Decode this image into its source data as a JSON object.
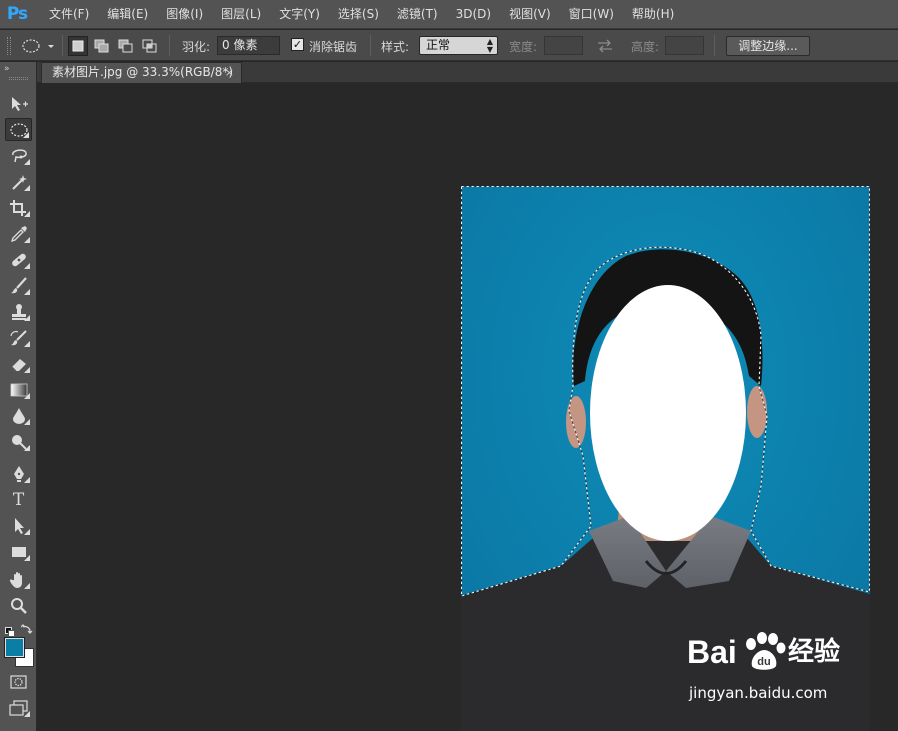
{
  "app": {
    "name": "Photoshop",
    "logo": "Ps"
  },
  "menu": [
    "文件(F)",
    "编辑(E)",
    "图像(I)",
    "图层(L)",
    "文字(Y)",
    "选择(S)",
    "滤镜(T)",
    "3D(D)",
    "视图(V)",
    "窗口(W)",
    "帮助(H)"
  ],
  "options": {
    "tool_icon": "elliptical-marquee-icon",
    "feather_label": "羽化:",
    "feather_value": "0 像素",
    "antialias_checked": true,
    "antialias_label": "消除锯齿",
    "style_label": "样式:",
    "style_value": "正常",
    "width_label": "宽度:",
    "width_value": "",
    "height_label": "高度:",
    "height_value": "",
    "refine_edge_label": "调整边缘..."
  },
  "document_tab": {
    "title": "素材图片.jpg @ 33.3%(RGB/8*)",
    "close": "×"
  },
  "tools": [
    "move-tool-icon",
    "elliptical-marquee-tool-icon",
    "lasso-tool-icon",
    "magic-wand-tool-icon",
    "crop-tool-icon",
    "eyedropper-tool-icon",
    "healing-brush-tool-icon",
    "brush-tool-icon",
    "clone-stamp-tool-icon",
    "history-brush-tool-icon",
    "eraser-tool-icon",
    "gradient-tool-icon",
    "blur-tool-icon",
    "dodge-tool-icon",
    "pen-tool-icon",
    "type-tool-icon",
    "path-selection-tool-icon",
    "rectangle-tool-icon",
    "hand-tool-icon",
    "zoom-tool-icon"
  ],
  "tool_type_glyph": "T",
  "colors": {
    "foreground": "#0b7ea6",
    "background": "#ffffff",
    "photo_background": "#0a84ab",
    "selection": "#ffffff"
  },
  "watermark": {
    "brand_left": "Bai",
    "brand_right": "经验",
    "url": "jingyan.baidu.com"
  }
}
